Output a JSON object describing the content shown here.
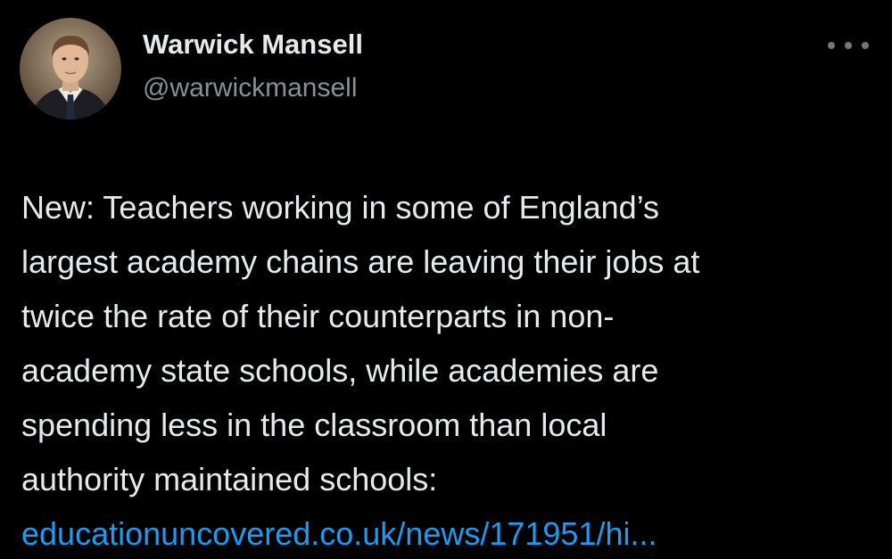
{
  "author": {
    "display_name": "Warwick Mansell",
    "handle": "@warwickmansell",
    "avatar_icon": "profile-photo"
  },
  "more_icon": "more-horizontal-icon",
  "tweet": {
    "lines": [
      "New: Teachers working in some of England’s",
      "largest academy chains are leaving their jobs at",
      "twice the rate of their counterparts in non-",
      "academy state schools, while academies are",
      "spending less in the classroom than local",
      "authority maintained schools:"
    ],
    "link": "educationuncovered.co.uk/news/171951/hi..."
  },
  "colors": {
    "background": "#000000",
    "text": "#e7e9ea",
    "secondary_text": "#8b8f94",
    "link": "#1d9bf0"
  }
}
